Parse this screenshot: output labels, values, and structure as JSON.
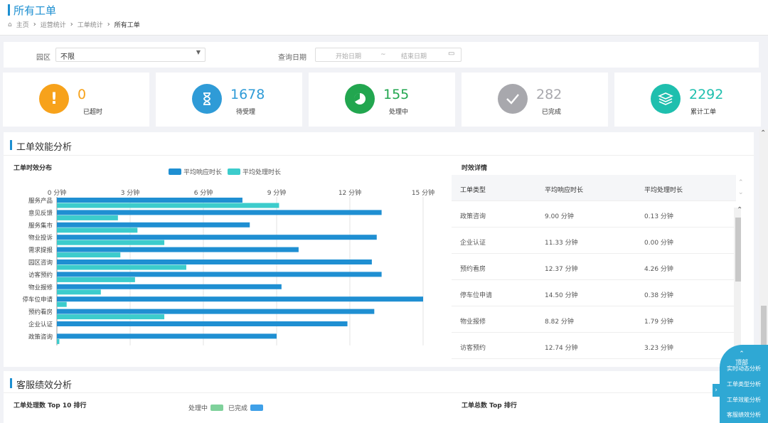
{
  "header": {
    "title": "所有工单",
    "breadcrumb": [
      "主页",
      "运营统计",
      "工单统计",
      "所有工单"
    ]
  },
  "filter": {
    "park_label": "园区",
    "park_value": "不限",
    "date_label": "查询日期",
    "start_placeholder": "开始日期",
    "range_sep": "~",
    "end_placeholder": "结束日期"
  },
  "stats": [
    {
      "value": "0",
      "label": "已超时",
      "color": "#f7a21b",
      "icon": "exclamation-icon"
    },
    {
      "value": "1678",
      "label": "待受理",
      "color": "#2f9bd7",
      "icon": "hourglass-icon"
    },
    {
      "value": "155",
      "label": "处理中",
      "color": "#22a64f",
      "icon": "pie-progress-icon"
    },
    {
      "value": "282",
      "label": "已完成",
      "color": "#a8a8ad",
      "icon": "check-icon"
    },
    {
      "value": "2292",
      "label": "累计工单",
      "color": "#1fbfae",
      "icon": "layers-icon"
    }
  ],
  "efficiency": {
    "section_title": "工单效能分析",
    "chart_title": "工单时效分布",
    "table_title": "时效详情"
  },
  "chart_data": {
    "type": "bar",
    "orientation": "horizontal",
    "categories": [
      "服务产品",
      "意见反馈",
      "服务集市",
      "物业投诉",
      "需求提报",
      "园区咨询",
      "访客预约",
      "物业报修",
      "停车位申请",
      "预约看房",
      "企业认证",
      "政策咨询"
    ],
    "series": [
      {
        "name": "平均响应时长",
        "color": "#1f8fd2",
        "values": [
          7.6,
          13.3,
          7.9,
          13.1,
          9.9,
          12.9,
          13.3,
          9.2,
          15.0,
          13.0,
          11.9,
          9.0
        ]
      },
      {
        "name": "平均处理时长",
        "color": "#3ccccc",
        "values": [
          9.1,
          2.5,
          3.3,
          4.4,
          2.6,
          5.3,
          3.2,
          1.8,
          0.4,
          4.4,
          0,
          0.1
        ]
      }
    ],
    "x_ticks": [
      "0 分钟",
      "3 分钟",
      "6 分钟",
      "9 分钟",
      "12 分钟",
      "15 分钟"
    ],
    "xlim": [
      0,
      15
    ],
    "grid": true,
    "legend_position": "top-center"
  },
  "detail_table": {
    "headers": [
      "工单类型",
      "平均响应时长",
      "平均处理时长"
    ],
    "rows": [
      [
        "政策咨询",
        "9.00 分钟",
        "0.13 分钟"
      ],
      [
        "企业认证",
        "11.33 分钟",
        "0.00 分钟"
      ],
      [
        "预约看房",
        "12.37 分钟",
        "4.26 分钟"
      ],
      [
        "停车位申请",
        "14.50 分钟",
        "0.38 分钟"
      ],
      [
        "物业报修",
        "8.82 分钟",
        "1.79 分钟"
      ],
      [
        "访客预约",
        "12.74 分钟",
        "3.23 分钟"
      ]
    ]
  },
  "service": {
    "section_title": "客服绩效分析",
    "left_title": "工单处理数 Top 10 排行",
    "legend_processing": "处理中",
    "legend_done": "已完成",
    "processing_color": "#7fd19b",
    "done_color": "#3fa0e8",
    "right_title": "工单总数 Top 排行"
  },
  "float_nav": {
    "top": "顶部",
    "items": [
      "实时动态分析",
      "工单类型分析",
      "工单效能分析",
      "客服绩效分析"
    ]
  }
}
